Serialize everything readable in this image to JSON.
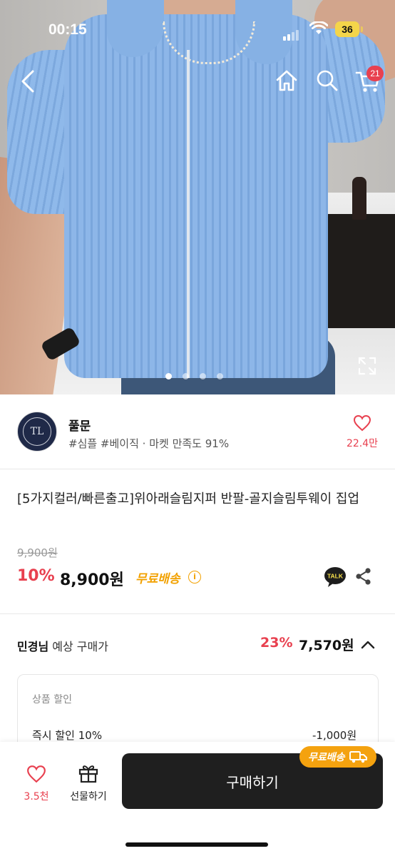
{
  "status_bar": {
    "time": "00:15",
    "battery": "36"
  },
  "nav": {
    "cart_count": "21"
  },
  "gallery": {
    "dot_count": 4,
    "active_index": 0
  },
  "store": {
    "name": "풀문",
    "meta": "#심플 #베이직 · 마켓 만족도 91%",
    "like_count": "22.4만",
    "logo_text": "TL"
  },
  "product": {
    "title": "[5가지컬러/빠른출고]위아래슬림지퍼 반팔-골지슬림투웨이 집업",
    "original_price": "9,900원",
    "discount_rate": "10%",
    "price": "8,900원",
    "shipping": "무료배송",
    "talk_label": "TALK"
  },
  "expected": {
    "member_name": "민경님",
    "label": "예상 구매가",
    "discount_rate": "23%",
    "price": "7,570원",
    "discount_header": "상품 할인",
    "instant_label": "즉시 할인 10%",
    "instant_value": "-1,000원"
  },
  "bottom": {
    "wish_count": "3.5천",
    "gift_label": "선물하기",
    "buy_label": "구매하기",
    "ship_badge": "무료배송"
  },
  "colors": {
    "accent_red": "#e8404f",
    "shipping_orange": "#f2a100",
    "buy_button": "#1f1f1f"
  }
}
